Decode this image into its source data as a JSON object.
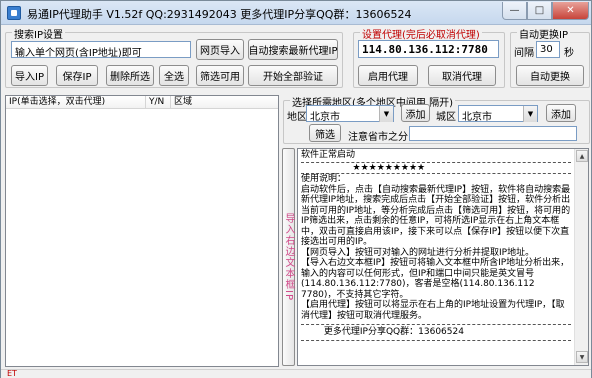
{
  "window": {
    "title": "易通IP代理助手 V1.52f  QQ:2931492043   更多代理IP分享QQ群：13606524",
    "min_glyph": "—",
    "max_glyph": "□",
    "close_glyph": "✕"
  },
  "search_group": {
    "title": "搜索IP设置",
    "url_value": "输入单个网页(含IP地址)即可",
    "page_import_label": "网页导入",
    "auto_search_label": "自动搜索最新代理IP",
    "import_ip_label": "导入IP",
    "save_ip_label": "保存IP",
    "delete_selected_label": "删除所选",
    "select_all_label": "全选",
    "filter_usable_label": "筛选可用",
    "start_verify_label": "开始全部验证"
  },
  "proxy_group": {
    "title": "设置代理(完后必取消代理)",
    "ip_value": "114.80.136.112:7780",
    "enable_label": "启用代理",
    "cancel_label": "取消代理"
  },
  "auto_change_group": {
    "title": "自动更换IP",
    "interval_label": "间隔",
    "interval_value": "30",
    "unit_label": "秒",
    "auto_change_label": "自动更换"
  },
  "ip_list": {
    "columns": [
      "IP(单击选择，双击代理)",
      "Y/N",
      "区域"
    ],
    "rows": []
  },
  "region_group": {
    "title": "选择所需地区(多个地区中间用.隔开)",
    "region_label": "地区",
    "region_value": "北京市",
    "add_label": "添加",
    "city_label": "城区",
    "city_value": "北京市",
    "add2_label": "添加",
    "filter_label": "筛选",
    "note_label": "注意省市之分",
    "filter_input_value": ""
  },
  "vertical_button": {
    "label": "导入右边文本框IP"
  },
  "log": {
    "lines": [
      "软件正常启动",
      "                  ★★★★★★★★★",
      "使用说明：",
      "启动软件后，点击【自动搜索最新代理IP】按钮，软件将自动搜索最新代理IP地址，搜索完成后点击【开始全部验证】按钮，软件分析出当前可用的IP地址，等分析完成后点击【筛选可用】按钮，将可用的IP筛选出来，点击剩余的任意IP，可将所选IP显示在右上角文本框中，双击可直接启用该IP，接下来可以点【保存IP】按钮以便下次直接选出可用的IP。",
      "【网页导入】按钮可对输入的网址进行分析并提取IP地址。",
      "【导入右边文本框IP】按钮可将输入文本框中所含IP地址分析出来，输入的内容可以任何形式，但IP和端口中间只能是英文冒号(114.80.136.112:7780)，客者是空格(114.80.136.112 7780)，不支持其它字符。",
      "【启用代理】按钮可以将显示在右上角的IP地址设置为代理IP，【取消代理】按钮可取消代理服务。",
      "        更多代理IP分享QQ群：13606524"
    ]
  },
  "status": {
    "text": "ET"
  }
}
